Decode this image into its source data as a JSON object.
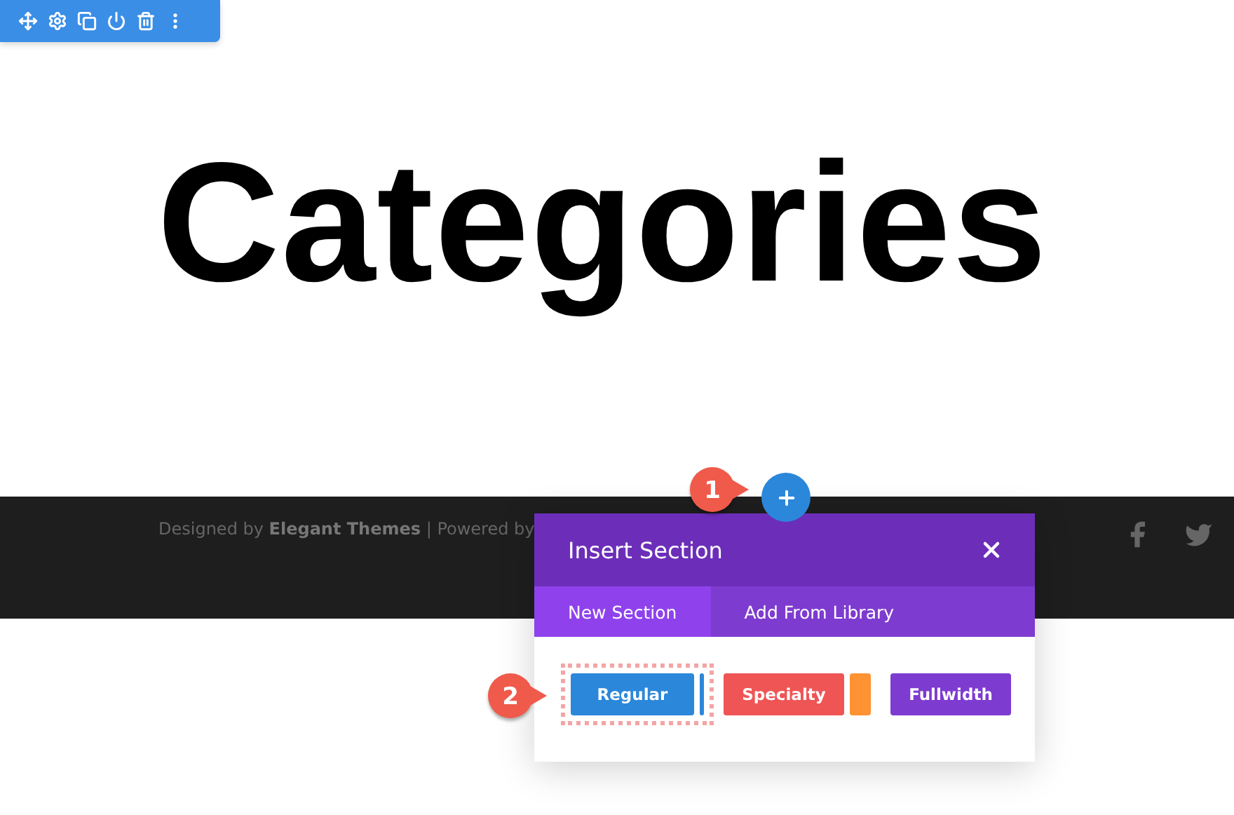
{
  "heading": {
    "title": "Categories"
  },
  "footer": {
    "credit": "Designed by **Elegant Themes** | Powered by"
  },
  "callouts": [
    {
      "number": "1"
    },
    {
      "number": "2"
    }
  ],
  "dialog": {
    "title": "Insert Section",
    "tabs": [
      {
        "label": "New Section",
        "selected": true
      },
      {
        "label": "Add From Library",
        "selected": false
      }
    ],
    "options": [
      {
        "label": "Regular",
        "kind": "regular",
        "highlighted": true
      },
      {
        "label": "Specialty",
        "kind": "specialty",
        "highlighted": false
      },
      {
        "label": "Fullwidth",
        "kind": "fullwidth",
        "highlighted": false
      }
    ]
  }
}
